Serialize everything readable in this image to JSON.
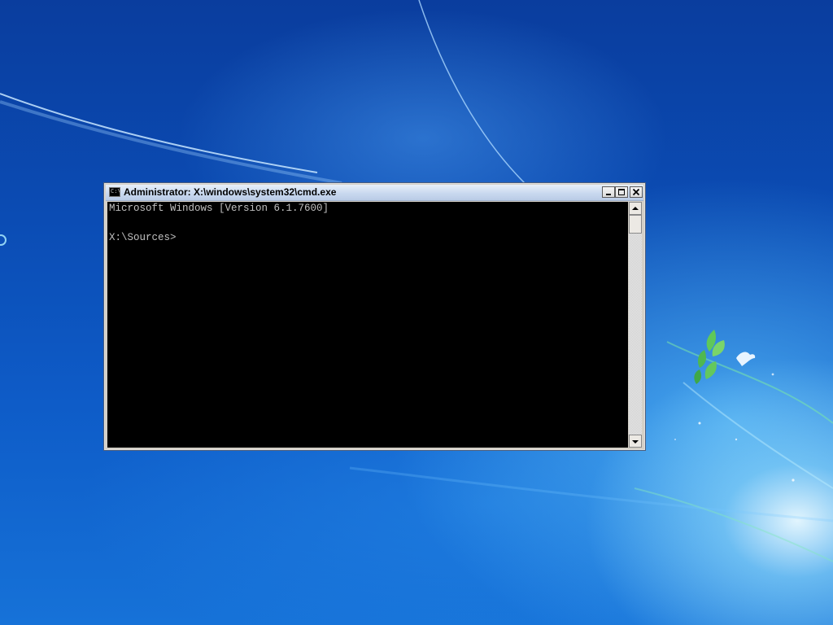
{
  "desktop": {
    "colors": {
      "top": "#0a3d9e",
      "bottom": "#1672d8",
      "glow": "#ebfaff",
      "logo_green": "#5fc85a",
      "logo_white": "#e8f4ff"
    },
    "icons": [
      "windows-logo-icon",
      "bird-icon"
    ]
  },
  "window": {
    "title": "Administrator: X:\\windows\\system32\\cmd.exe",
    "icon_text": "C:\\",
    "icons": [
      "cmd-icon",
      "minimize-icon",
      "maximize-icon",
      "close-icon",
      "scroll-up-arrow-icon",
      "scroll-down-arrow-icon"
    ],
    "colors": {
      "title_bar": "#c9d9ef",
      "frame": "#d4d0c8",
      "console_bg": "#000000",
      "console_text": "#c0c0c0"
    }
  },
  "console": {
    "lines": [
      "Microsoft Windows [Version 6.1.7600]",
      "X:\\Sources>"
    ]
  }
}
